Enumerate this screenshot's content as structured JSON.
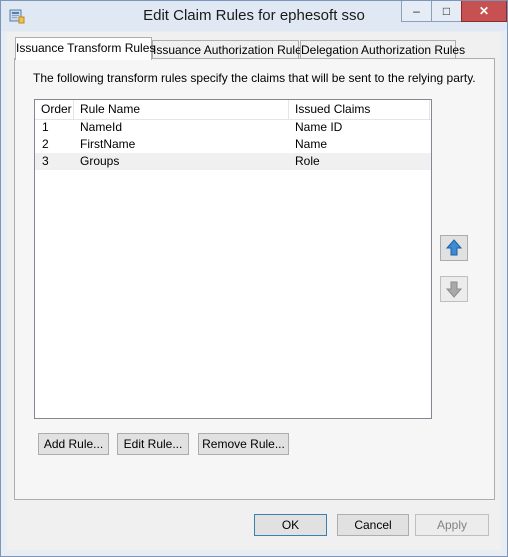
{
  "window": {
    "title": "Edit Claim Rules for ephesoft sso",
    "minimize_glyph": "–",
    "maximize_glyph": "□",
    "close_glyph": "✕"
  },
  "tabs": [
    {
      "label": "Issuance Transform Rules",
      "active": true
    },
    {
      "label": "Issuance Authorization Rules",
      "active": false
    },
    {
      "label": "Delegation Authorization Rules",
      "active": false
    }
  ],
  "panel": {
    "description": "The following transform rules specify the claims that will be sent to the relying party.",
    "columns": {
      "order": "Order",
      "rule_name": "Rule Name",
      "issued_claims": "Issued Claims"
    },
    "rows": [
      {
        "order": "1",
        "rule_name": "NameId",
        "issued_claims": "Name ID",
        "selected": false
      },
      {
        "order": "2",
        "rule_name": "FirstName",
        "issued_claims": "Name",
        "selected": false
      },
      {
        "order": "3",
        "rule_name": "Groups",
        "issued_claims": "Role",
        "selected": true
      }
    ],
    "move_up_icon": "arrow-up-icon",
    "move_down_icon": "arrow-down-icon",
    "buttons": {
      "add": "Add Rule...",
      "edit": "Edit Rule...",
      "remove": "Remove Rule..."
    }
  },
  "dialog_buttons": {
    "ok": "OK",
    "cancel": "Cancel",
    "apply": "Apply"
  },
  "colors": {
    "accent_arrow": "#3b8bd6",
    "disabled_arrow": "#a9a9a9",
    "close_button": "#c75050"
  }
}
